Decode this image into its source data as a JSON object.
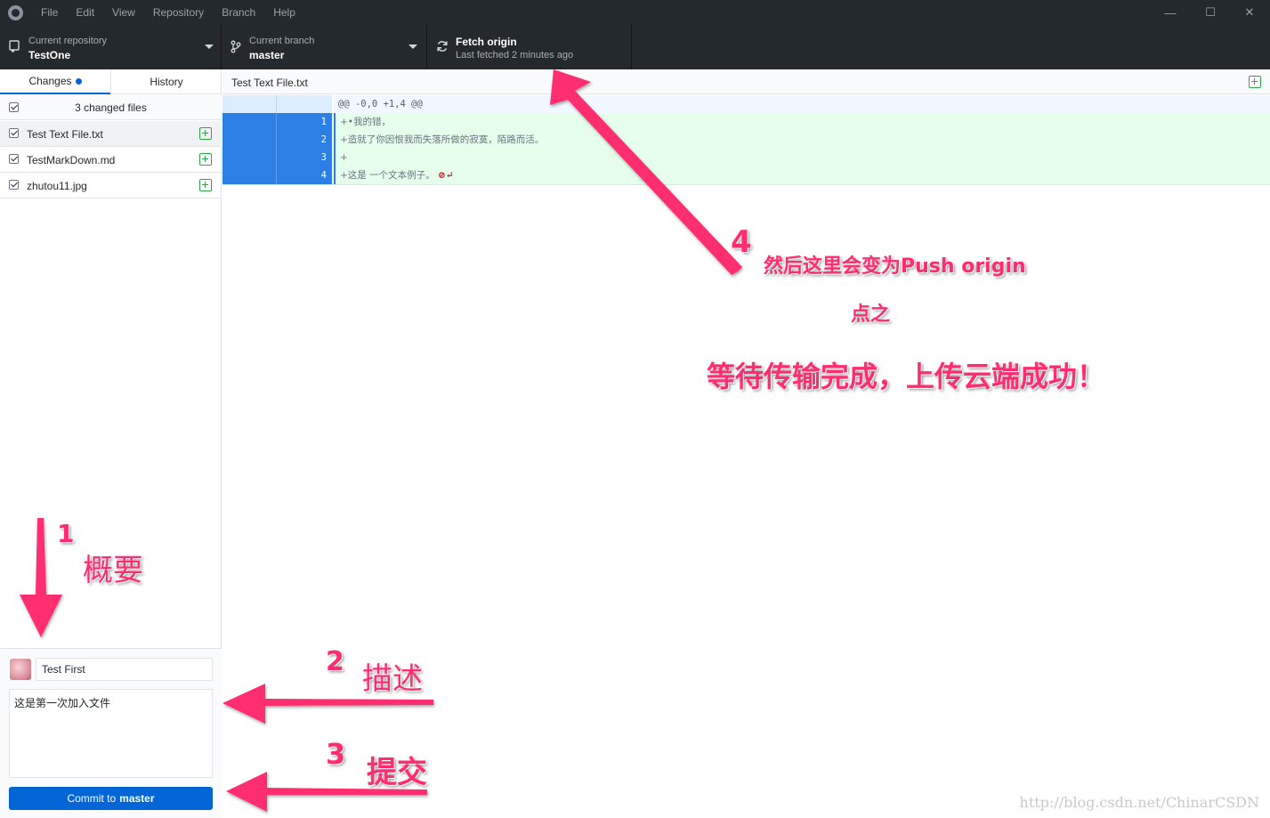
{
  "titlebar": {
    "menu": [
      "File",
      "Edit",
      "View",
      "Repository",
      "Branch",
      "Help"
    ],
    "window_controls": [
      "minimize-icon",
      "maximize-icon",
      "close-icon"
    ]
  },
  "toolbar": {
    "repository": {
      "label": "Current repository",
      "value": "TestOne"
    },
    "branch": {
      "label": "Current branch",
      "value": "master"
    },
    "fetch": {
      "title": "Fetch origin",
      "subtitle": "Last fetched 2 minutes ago"
    }
  },
  "sidebar": {
    "tabs": {
      "changes": "Changes",
      "history": "History"
    },
    "changes_header": "3 changed files",
    "files": [
      {
        "name": "Test Text File.txt",
        "checked": true,
        "status": "added"
      },
      {
        "name": "TestMarkDown.md",
        "checked": true,
        "status": "added"
      },
      {
        "name": "zhutou11.jpg",
        "checked": true,
        "status": "added"
      }
    ]
  },
  "commit": {
    "summary": "Test First",
    "description": "这是第一次加入文件",
    "button_prefix": "Commit to",
    "button_branch": "master"
  },
  "diff": {
    "file_path": "Test Text File.txt",
    "hunk_header": "@@ -0,0 +1,4 @@",
    "lines": [
      {
        "num": "1",
        "text": "+•我的错，"
      },
      {
        "num": "2",
        "text": "+造就了你因恨我而失落所做的寂寞，陌路而活。"
      },
      {
        "num": "3",
        "text": "+"
      },
      {
        "num": "4",
        "text": "+这是 一个文本例子。"
      }
    ],
    "no_newline_marker": "⊘↵"
  },
  "annotations": {
    "step1_num": "1",
    "step1_text": "概要",
    "step2_num": "2",
    "step2_text": "描述",
    "step3_num": "3",
    "step3_text": "提交",
    "step4_num": "4",
    "step4_line1": "然后这里会变为Push  origin",
    "step4_line2": "点之",
    "step4_line3": "等待传输完成，上传云端成功！",
    "accent_color": "#ff2d6f"
  },
  "watermark": "http://blog.csdn.net/ChinarCSDN"
}
